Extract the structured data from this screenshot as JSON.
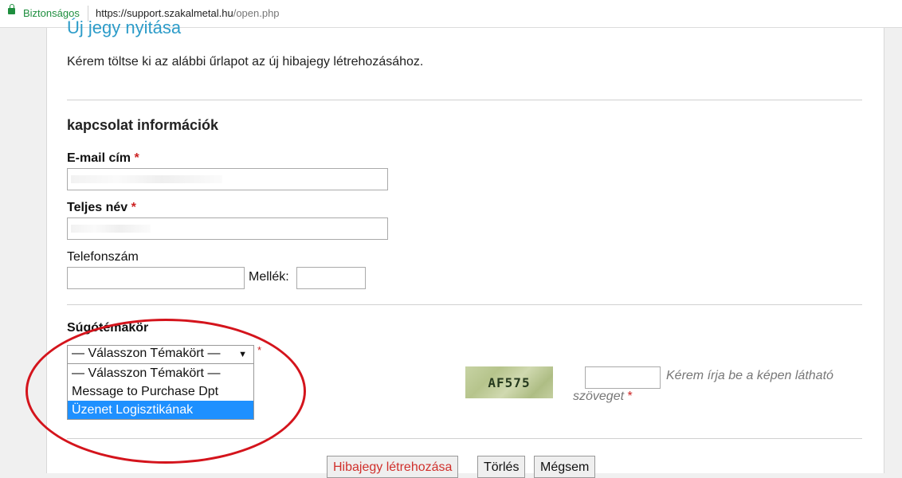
{
  "browser": {
    "secure_label": "Biztonságos",
    "url_host": "https://support.szakalmetal.hu",
    "url_path": "/open.php"
  },
  "page": {
    "title": "Új jegy nyitása",
    "intro": "Kérem töltse ki az alábbi űrlapot az új hibajegy létrehozásához."
  },
  "contact": {
    "section_title": "kapcsolat információk",
    "email_label": "E-mail cím",
    "name_label": "Teljes név",
    "phone_label": "Telefonszám",
    "ext_label": "Mellék:",
    "required_mark": "*"
  },
  "topic": {
    "label": "Súgótémakör",
    "selected": "— Válasszon Témakört —",
    "options": [
      "— Válasszon Témakört —",
      "Message to Purchase Dpt",
      "Üzenet Logisztikának"
    ],
    "highlighted_index": 2
  },
  "captcha": {
    "code": "AF575",
    "hint_line1": "Kérem írja be a képen látható",
    "hint_line2": "szöveget"
  },
  "buttons": {
    "create": "Hibajegy létrehozása",
    "reset": "Törlés",
    "cancel": "Mégsem"
  },
  "colors": {
    "title": "#2d9cc9",
    "required": "#cc2222",
    "highlight": "#1e90ff",
    "annotation_ellipse": "#d4141c",
    "secure": "#1e8e3e"
  }
}
